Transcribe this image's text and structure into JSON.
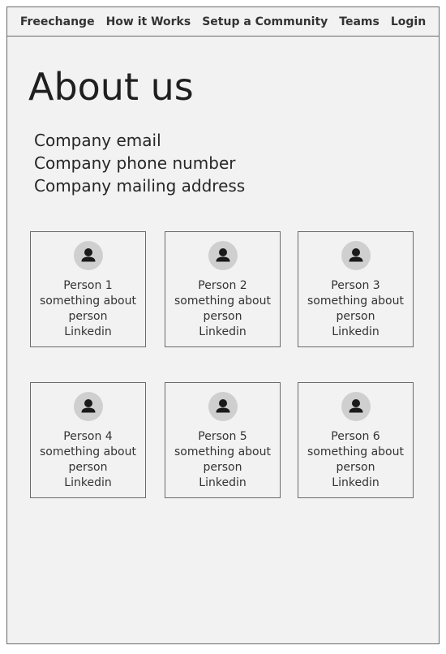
{
  "nav": {
    "items": [
      "Freechange",
      "How it Works",
      "Setup a Community",
      "Teams",
      "Login"
    ]
  },
  "page": {
    "title": "About us"
  },
  "contact": {
    "email": "Company email",
    "phone": "Company phone number",
    "address": "Company mailing address"
  },
  "team": {
    "members": [
      {
        "name": "Person 1",
        "description": "something about person",
        "link": "Linkedin"
      },
      {
        "name": "Person 2",
        "description": "something about person",
        "link": "Linkedin"
      },
      {
        "name": "Person 3",
        "description": "something about person",
        "link": "Linkedin"
      },
      {
        "name": "Person 4",
        "description": "something about person",
        "link": "Linkedin"
      },
      {
        "name": "Person 5",
        "description": "something about person",
        "link": "Linkedin"
      },
      {
        "name": "Person 6",
        "description": "something about person",
        "link": "Linkedin"
      }
    ]
  },
  "icons": {
    "avatar": "user-icon"
  },
  "colors": {
    "background": "#f2f2f2",
    "border": "#6a6a6a",
    "avatar_bg": "#cfcfcf",
    "text": "#222222"
  }
}
